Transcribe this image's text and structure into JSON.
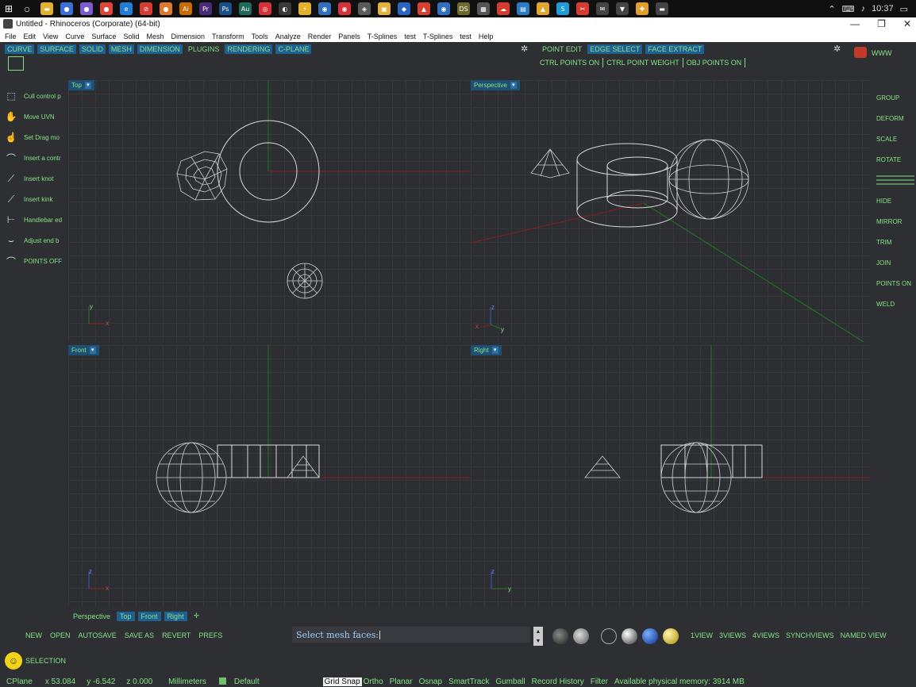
{
  "taskbar": {
    "time": "10:37",
    "icons": [
      {
        "name": "search-icon",
        "glyph": "○",
        "color": "#101010"
      },
      {
        "name": "folder-icon",
        "glyph": "▬",
        "color": "#e3b02f"
      },
      {
        "name": "app-icon",
        "glyph": "●",
        "color": "#3a6fd8"
      },
      {
        "name": "app-icon",
        "glyph": "●",
        "color": "#7a5ccf"
      },
      {
        "name": "chrome-icon",
        "glyph": "●",
        "color": "#e0453a"
      },
      {
        "name": "edge-icon",
        "glyph": "e",
        "color": "#1f7dd8"
      },
      {
        "name": "app-icon",
        "glyph": "⊘",
        "color": "#d63b2f"
      },
      {
        "name": "firefox-icon",
        "glyph": "●",
        "color": "#e2772b"
      },
      {
        "name": "illustrator-icon",
        "glyph": "Ai",
        "color": "#c96b00"
      },
      {
        "name": "premiere-icon",
        "glyph": "Pr",
        "color": "#4a2b7a"
      },
      {
        "name": "photoshop-icon",
        "glyph": "Ps",
        "color": "#1b4f8a"
      },
      {
        "name": "audition-icon",
        "glyph": "Au",
        "color": "#1d6a5b"
      },
      {
        "name": "app-icon",
        "glyph": "◎",
        "color": "#d6303a"
      },
      {
        "name": "app-icon",
        "glyph": "◐",
        "color": "#3a3a3a"
      },
      {
        "name": "app-icon",
        "glyph": "⚡",
        "color": "#e1b32b"
      },
      {
        "name": "app-icon",
        "glyph": "◉",
        "color": "#2f6fbf"
      },
      {
        "name": "app-icon",
        "glyph": "◉",
        "color": "#d6303a"
      },
      {
        "name": "app-icon",
        "glyph": "◈",
        "color": "#5a5a5a"
      },
      {
        "name": "app-icon",
        "glyph": "▣",
        "color": "#e4b23c"
      },
      {
        "name": "app-icon",
        "glyph": "◆",
        "color": "#2a65c4"
      },
      {
        "name": "app-icon",
        "glyph": "▲",
        "color": "#d8402f"
      },
      {
        "name": "app-icon",
        "glyph": "◉",
        "color": "#2f6fbf"
      },
      {
        "name": "app-icon",
        "glyph": "DS",
        "color": "#6b6b2f"
      },
      {
        "name": "app-icon",
        "glyph": "▦",
        "color": "#555"
      },
      {
        "name": "app-icon",
        "glyph": "☁",
        "color": "#d63b2f"
      },
      {
        "name": "app-icon",
        "glyph": "▤",
        "color": "#2a7ac4"
      },
      {
        "name": "app-icon",
        "glyph": "▲",
        "color": "#e1a62b"
      },
      {
        "name": "skype-icon",
        "glyph": "S",
        "color": "#1f9bd8"
      },
      {
        "name": "app-icon",
        "glyph": "✂",
        "color": "#d63b2f"
      },
      {
        "name": "mail-icon",
        "glyph": "✉",
        "color": "#444"
      },
      {
        "name": "app-icon",
        "glyph": "▼",
        "color": "#444"
      },
      {
        "name": "app-icon",
        "glyph": "✚",
        "color": "#e2a02b"
      },
      {
        "name": "app-icon",
        "glyph": "▬",
        "color": "#444"
      }
    ]
  },
  "window": {
    "title": "Untitled - Rhinoceros (Corporate) (64-bit)",
    "minimize": "—",
    "restore": "❐",
    "close": "✕"
  },
  "menu": [
    "File",
    "Edit",
    "View",
    "Curve",
    "Surface",
    "Solid",
    "Mesh",
    "Dimension",
    "Transform",
    "Tools",
    "Analyze",
    "Render",
    "Panels",
    "T-Splines",
    "test",
    "T-Splines",
    "test",
    "Help"
  ],
  "toolbar_tabs": [
    "CURVE",
    "SURFACE",
    "SOLID",
    "MESH",
    "DIMENSION",
    "PLUGINS",
    "RENDERING",
    "C-PLANE"
  ],
  "edit_tabs": [
    "POINT EDIT",
    "EDGE SELECT",
    "FACE EXTRACT"
  ],
  "edit_buttons": [
    "CTRL POINTS ON",
    "CTRL POINT WEIGHT",
    "OBJ POINTS ON"
  ],
  "www_label": "WWW",
  "left_tools": [
    {
      "label": "Cull control p",
      "icon": "cull-control-points-icon",
      "glyph": "⬚"
    },
    {
      "label": "Move UVN",
      "icon": "move-uvn-icon",
      "glyph": "✋"
    },
    {
      "label": "Set Drag mo",
      "icon": "set-drag-mode-icon",
      "glyph": "☝"
    },
    {
      "label": "Insert a contr",
      "icon": "insert-control-point-icon",
      "glyph": "⌒"
    },
    {
      "label": "Insert knot",
      "icon": "insert-knot-icon",
      "glyph": "⟋"
    },
    {
      "label": "Insert kink",
      "icon": "insert-kink-icon",
      "glyph": "⟋"
    },
    {
      "label": "Handlebar ed",
      "icon": "handlebar-editor-icon",
      "glyph": "⊢"
    },
    {
      "label": "Adjust end b",
      "icon": "adjust-end-bulge-icon",
      "glyph": "⌣"
    },
    {
      "label": "POINTS OFF",
      "icon": "points-off-icon",
      "glyph": "⌒"
    }
  ],
  "right_tools": [
    "GROUP",
    "DEFORM",
    "SCALE",
    "ROTATE",
    "",
    "HIDE",
    "MIRROR",
    "TRIM",
    "JOIN",
    "POINTS ON",
    "WELD"
  ],
  "viewports": {
    "top": {
      "label": "Top"
    },
    "perspective": {
      "label": "Perspective"
    },
    "front": {
      "label": "Front"
    },
    "right": {
      "label": "Right"
    }
  },
  "axis_labels": {
    "x": "x",
    "y": "y",
    "z": "z"
  },
  "view_tabs": [
    "Perspective",
    "Top",
    "Front",
    "Right"
  ],
  "view_tabs_add": "✛",
  "file_buttons": [
    "NEW",
    "OPEN",
    "AUTOSAVE",
    "SAVE AS",
    "REVERT",
    "PREFS"
  ],
  "command": {
    "prompt": "Select mesh faces:"
  },
  "view_buttons": [
    "1VIEW",
    "3VIEWS",
    "4VIEWS",
    "SYNCHVIEWS",
    "NAMED VIEW"
  ],
  "selection_label": "SELECTION",
  "status": {
    "cplane": "CPlane",
    "x": "x 53.084",
    "y": "y -6.542",
    "z": "z 0.000",
    "units": "Millimeters",
    "layer": "Default",
    "grid_snap": "Grid Snap",
    "ortho": "Ortho",
    "planar": "Planar",
    "osnap": "Osnap",
    "smarttrack": "SmartTrack",
    "gumball": "Gumball",
    "record_history": "Record History",
    "filter": "Filter",
    "memory": "Available physical memory: 3914 MB"
  },
  "colors": {
    "accent_green": "#86e486",
    "tab_blue": "#1f5f92",
    "x_axis": "#8a1e1e",
    "y_axis": "#1e7a1e",
    "wire": "#d8d8d8"
  }
}
